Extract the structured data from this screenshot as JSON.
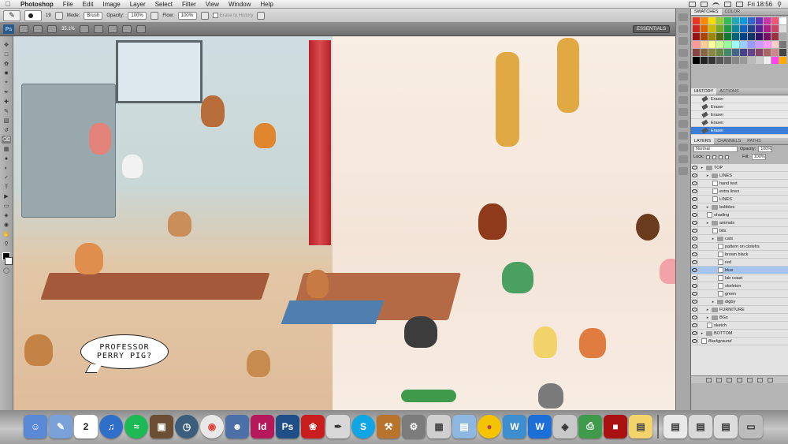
{
  "menubar": {
    "app": "Photoshop",
    "items": [
      "File",
      "Edit",
      "Image",
      "Layer",
      "Select",
      "Filter",
      "View",
      "Window",
      "Help"
    ],
    "clock": "Fri 18:56"
  },
  "options_bar": {
    "size": "19",
    "mode_label": "Mode:",
    "mode_value": "Brush",
    "opacity_label": "Opacity:",
    "opacity_value": "100%",
    "flow_label": "Flow:",
    "flow_value": "100%",
    "erase_history": "Erase to History"
  },
  "app_bar": {
    "logo": "Ps",
    "zoom": "35.1%",
    "workspace": "ESSENTIALS"
  },
  "artwork": {
    "speech_line1": "PROFESSOR",
    "speech_line2": "PERRY PIG?"
  },
  "panels": {
    "swatches_tabs": [
      "SWATCHES",
      "COLOR"
    ],
    "history_tabs": [
      "HISTORY",
      "ACTIONS"
    ],
    "history_items": [
      "Eraser",
      "Eraser",
      "Eraser",
      "Eraser",
      "Eraser"
    ],
    "layers_tabs": [
      "LAYERS",
      "CHANNELS",
      "PATHS"
    ],
    "blend_mode": "Normal",
    "opacity_label": "Opacity:",
    "opacity_value": "100%",
    "lock_label": "Lock:",
    "fill_label": "Fill:",
    "fill_value": "100%",
    "layers": [
      {
        "name": "TOP",
        "kind": "folder"
      },
      {
        "name": "LINES",
        "kind": "folder"
      },
      {
        "name": "hand text",
        "kind": "layer"
      },
      {
        "name": "extra lines",
        "kind": "layer"
      },
      {
        "name": "LINES",
        "kind": "layer"
      },
      {
        "name": "bubbles",
        "kind": "folder"
      },
      {
        "name": "shading",
        "kind": "layer"
      },
      {
        "name": "animals",
        "kind": "folder"
      },
      {
        "name": "bits",
        "kind": "layer"
      },
      {
        "name": "cats",
        "kind": "folder"
      },
      {
        "name": "pattern on clotehs",
        "kind": "layer"
      },
      {
        "name": "brown black",
        "kind": "layer"
      },
      {
        "name": "red",
        "kind": "layer"
      },
      {
        "name": "blue",
        "kind": "layer"
      },
      {
        "name": "lab coast",
        "kind": "layer"
      },
      {
        "name": "skeleton",
        "kind": "layer"
      },
      {
        "name": "green",
        "kind": "layer"
      },
      {
        "name": "digby",
        "kind": "folder"
      },
      {
        "name": "FURNITURE",
        "kind": "folder"
      },
      {
        "name": "BGs",
        "kind": "folder"
      },
      {
        "name": "sketch",
        "kind": "layer"
      },
      {
        "name": "BOTTOM",
        "kind": "folder"
      },
      {
        "name": "Background",
        "kind": "layer"
      }
    ],
    "selected_layer": "blue"
  },
  "dock": {
    "calendar_day": "2",
    "indesign": "Id",
    "photoshop": "Ps"
  },
  "colors": {
    "selection": "#3d7fd8",
    "layer_selected": "#a5c4ee",
    "curtain": "#b52229"
  }
}
